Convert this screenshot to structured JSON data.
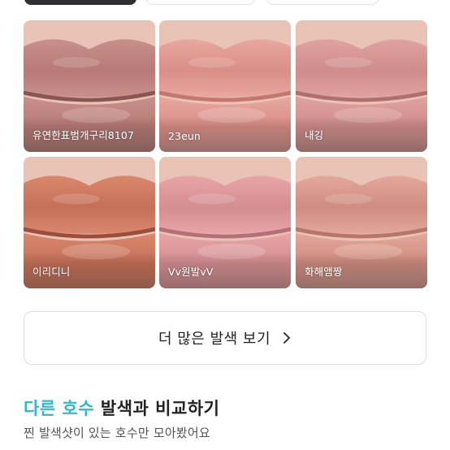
{
  "tabs": [
    {
      "label": "",
      "active": true
    },
    {
      "label": "",
      "active": false
    },
    {
      "label": "",
      "active": false
    }
  ],
  "swatches": [
    {
      "user": "유연한표범개구리8107",
      "colors": [
        "#c9908a",
        "#b87a76",
        "#8a5550"
      ]
    },
    {
      "user": "23eun",
      "colors": [
        "#e8a8a0",
        "#d98e86",
        "#c27870"
      ]
    },
    {
      "user": "내깅",
      "colors": [
        "#e0a3a0",
        "#cf8c8a",
        "#b06f6e"
      ]
    },
    {
      "user": "이리디니",
      "colors": [
        "#d9876e",
        "#c57058",
        "#9c4e3c"
      ]
    },
    {
      "user": "Vv원발vV",
      "colors": [
        "#e8a4a6",
        "#d48e92",
        "#b47078"
      ]
    },
    {
      "user": "화해앰짱",
      "colors": [
        "#e3a89b",
        "#cf8c80",
        "#b8766b"
      ]
    }
  ],
  "more_button": {
    "label": "더 많은 발색 보기",
    "icon": "chevron-right-icon"
  },
  "section": {
    "title_accent": "다른 호수",
    "title_rest": " 발색과 비교하기",
    "subtitle": "찐 발색샷이 있는 호수만 모아봤어요"
  },
  "colors": {
    "accent": "#36b6c9",
    "text": "#222222",
    "border": "#dcdcdc"
  }
}
